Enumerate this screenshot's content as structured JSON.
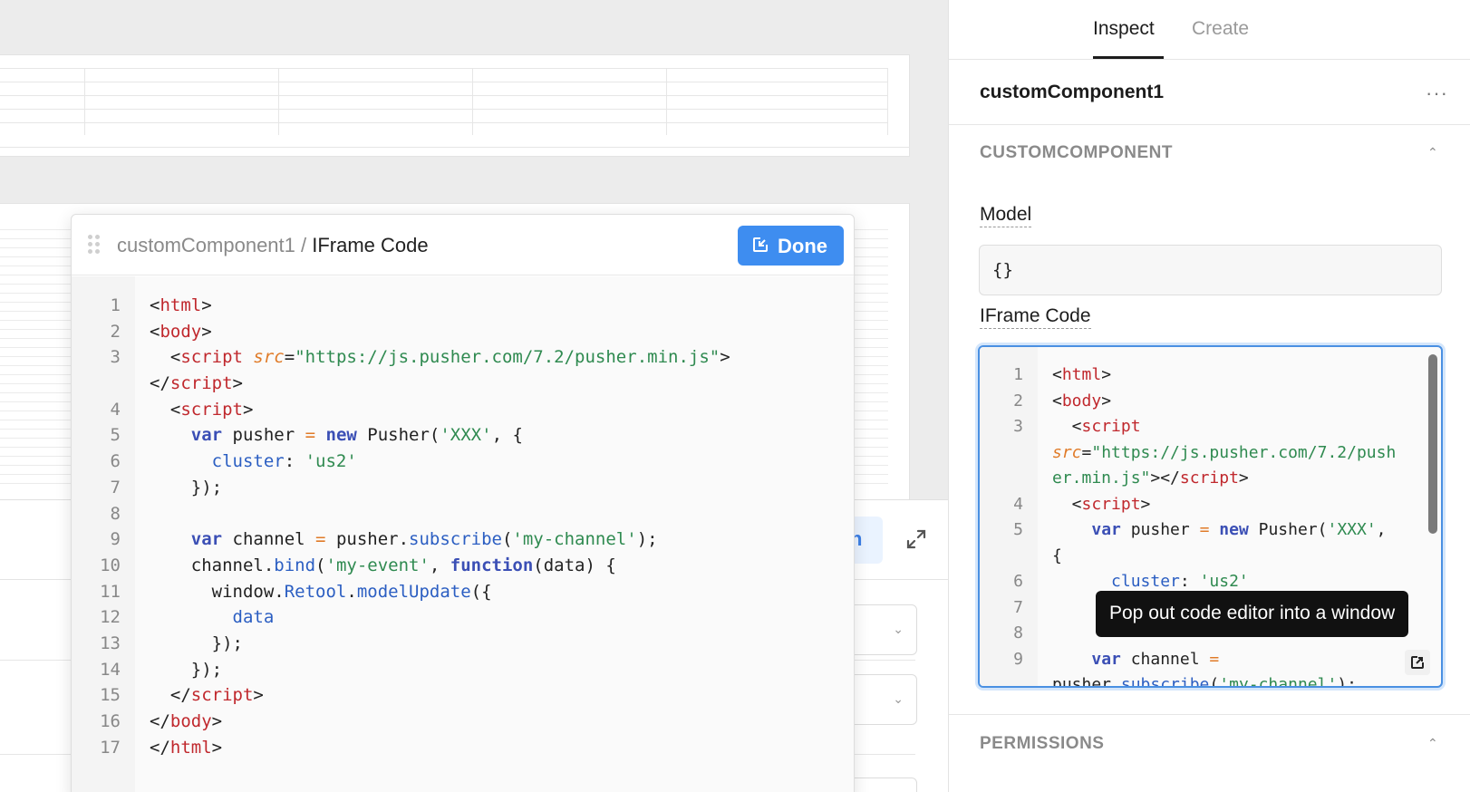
{
  "inspector": {
    "tabs": [
      {
        "label": "Inspect",
        "active": true
      },
      {
        "label": "Create",
        "active": false
      }
    ],
    "component_name": "customComponent1",
    "more_menu": "···",
    "section_customcomponent": "CUSTOMCOMPONENT",
    "model_label": "Model",
    "model_value": "{}",
    "iframe_code_label": "IFrame Code",
    "section_permissions": "PERMISSIONS",
    "tooltip": "Pop out code editor into a window",
    "mini_editor_lines": [
      {
        "n": "1",
        "html": "<span>&lt;</span><span class=\"t\">html</span><span>&gt;</span>"
      },
      {
        "n": "2",
        "html": "<span>&lt;</span><span class=\"t\">body</span><span>&gt;</span>"
      },
      {
        "n": "3",
        "html": "  &lt;<span class=\"t\">script</span>"
      },
      {
        "n": "",
        "html": "<span class=\"a\">src</span>=<span class=\"s\">\"https://js.pusher.com/7.2/push</span>"
      },
      {
        "n": "",
        "html": "<span class=\"s\">er.min.js\"</span>&gt;&lt;/<span class=\"t\">script</span>&gt;"
      },
      {
        "n": "4",
        "html": "  &lt;<span class=\"t\">script</span>&gt;"
      },
      {
        "n": "5",
        "html": "    <span class=\"k\">var</span> pusher <span class=\"o\">=</span> <span class=\"k\">new</span> Pusher(<span class=\"s\">'XXX'</span>,"
      },
      {
        "n": "",
        "html": "{"
      },
      {
        "n": "6",
        "html": "      <span class=\"p\">cluster</span>: <span class=\"s\">'us2'</span>"
      },
      {
        "n": "7",
        "html": ""
      },
      {
        "n": "8",
        "html": ""
      },
      {
        "n": "9",
        "html": "    <span class=\"k\">var</span> channel <span class=\"o\">=</span>"
      },
      {
        "n": "",
        "html": "pusher.<span class=\"p\">subscribe</span>(<span class=\"s\">'my-channel'</span>);"
      }
    ]
  },
  "modal": {
    "breadcrumb_parent": "customComponent1",
    "breadcrumb_sep": " / ",
    "breadcrumb_current": "IFrame Code",
    "done_label": "Done",
    "code_lines": [
      {
        "n": "1",
        "html": "&lt;<span class=\"t\">html</span>&gt;"
      },
      {
        "n": "2",
        "html": "&lt;<span class=\"t\">body</span>&gt;"
      },
      {
        "n": "3",
        "html": "  &lt;<span class=\"t\">script</span> <span class=\"a\">src</span>=<span class=\"s\">\"https://js.pusher.com/7.2/pusher.min.js\"</span>&gt;"
      },
      {
        "n": "",
        "html": "&lt;/<span class=\"t\">script</span>&gt;"
      },
      {
        "n": "4",
        "html": "  &lt;<span class=\"t\">script</span>&gt;"
      },
      {
        "n": "5",
        "html": "    <span class=\"k\">var</span> pusher <span class=\"o\">=</span> <span class=\"k\">new</span> Pusher(<span class=\"s\">'XXX'</span>, {"
      },
      {
        "n": "6",
        "html": "      <span class=\"p\">cluster</span>: <span class=\"s\">'us2'</span>"
      },
      {
        "n": "7",
        "html": "    });"
      },
      {
        "n": "8",
        "html": ""
      },
      {
        "n": "9",
        "html": "    <span class=\"k\">var</span> channel <span class=\"o\">=</span> pusher.<span class=\"p\">subscribe</span>(<span class=\"s\">'my-channel'</span>);"
      },
      {
        "n": "10",
        "html": "    channel.<span class=\"p\">bind</span>(<span class=\"s\">'my-event'</span>, <span class=\"k\">function</span>(data) {"
      },
      {
        "n": "11",
        "html": "      window.<span class=\"p\">Retool</span>.<span class=\"p\">modelUpdate</span>({"
      },
      {
        "n": "12",
        "html": "        <span class=\"p\">data</span>"
      },
      {
        "n": "13",
        "html": "      });"
      },
      {
        "n": "14",
        "html": "    });"
      },
      {
        "n": "15",
        "html": "  &lt;/<span class=\"t\">script</span>&gt;"
      },
      {
        "n": "16",
        "html": "&lt;/<span class=\"t\">body</span>&gt;"
      },
      {
        "n": "17",
        "html": "&lt;/<span class=\"t\">html</span>&gt;"
      }
    ]
  },
  "background": {
    "button_fragment": "n"
  },
  "colors": {
    "accent": "#3e8df0",
    "tag": "#c0282d",
    "string": "#2f8a50",
    "keyword": "#3b4fb5",
    "attribute": "#e07b28"
  },
  "icons": [
    "drag-handle-icon",
    "popout-icon",
    "expand-icon",
    "chevron-up-icon",
    "chevron-down-icon",
    "more-horizontal-icon"
  ]
}
